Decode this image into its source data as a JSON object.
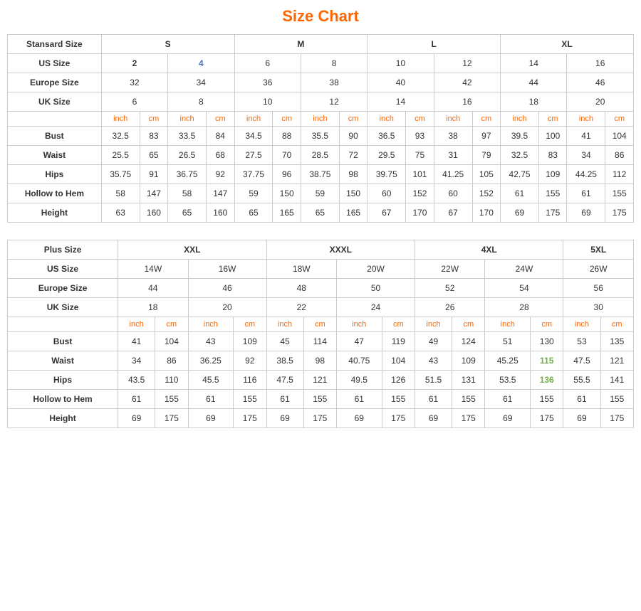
{
  "title": "Size Chart",
  "standard": {
    "table1": {
      "headers": {
        "col1": "Stansard Size",
        "s": "S",
        "m": "M",
        "l": "L",
        "xl": "XL"
      },
      "usSize": {
        "label": "US Size",
        "vals": [
          "2",
          "4",
          "6",
          "8",
          "10",
          "12",
          "14",
          "16"
        ]
      },
      "europeSize": {
        "label": "Europe Size",
        "vals": [
          "32",
          "34",
          "36",
          "38",
          "40",
          "42",
          "44",
          "46"
        ]
      },
      "ukSize": {
        "label": "UK Size",
        "vals": [
          "6",
          "8",
          "10",
          "12",
          "14",
          "16",
          "18",
          "20"
        ]
      },
      "units": [
        "inch",
        "cm",
        "inch",
        "cm",
        "inch",
        "cm",
        "inch",
        "cm",
        "inch",
        "cm",
        "inch",
        "cm",
        "inch",
        "cm",
        "inch",
        "cm"
      ],
      "bust": {
        "label": "Bust",
        "vals": [
          "32.5",
          "83",
          "33.5",
          "84",
          "34.5",
          "88",
          "35.5",
          "90",
          "36.5",
          "93",
          "38",
          "97",
          "39.5",
          "100",
          "41",
          "104"
        ]
      },
      "waist": {
        "label": "Waist",
        "vals": [
          "25.5",
          "65",
          "26.5",
          "68",
          "27.5",
          "70",
          "28.5",
          "72",
          "29.5",
          "75",
          "31",
          "79",
          "32.5",
          "83",
          "34",
          "86"
        ]
      },
      "hips": {
        "label": "Hips",
        "vals": [
          "35.75",
          "91",
          "36.75",
          "92",
          "37.75",
          "96",
          "38.75",
          "98",
          "39.75",
          "101",
          "41.25",
          "105",
          "42.75",
          "109",
          "44.25",
          "112"
        ]
      },
      "hollowToHem": {
        "label": "Hollow to Hem",
        "vals": [
          "58",
          "147",
          "58",
          "147",
          "59",
          "150",
          "59",
          "150",
          "60",
          "152",
          "60",
          "152",
          "61",
          "155",
          "61",
          "155"
        ]
      },
      "height": {
        "label": "Height",
        "vals": [
          "63",
          "160",
          "65",
          "160",
          "65",
          "165",
          "65",
          "165",
          "67",
          "170",
          "67",
          "170",
          "69",
          "175",
          "69",
          "175"
        ]
      }
    }
  },
  "plus": {
    "table2": {
      "headers": {
        "col1": "Plus Size",
        "xxl": "XXL",
        "xxxl": "XXXL",
        "fxl": "4XL",
        "fivexl": "5XL"
      },
      "usSize": {
        "label": "US Size",
        "vals": [
          "14W",
          "16W",
          "18W",
          "20W",
          "22W",
          "24W",
          "26W"
        ]
      },
      "europeSize": {
        "label": "Europe Size",
        "vals": [
          "44",
          "46",
          "48",
          "50",
          "52",
          "54",
          "56"
        ]
      },
      "ukSize": {
        "label": "UK Size",
        "vals": [
          "18",
          "20",
          "22",
          "24",
          "26",
          "28",
          "30"
        ]
      },
      "units": [
        "inch",
        "cm",
        "inch",
        "cm",
        "inch",
        "cm",
        "inch",
        "cm",
        "inch",
        "cm",
        "inch",
        "cm",
        "inch",
        "cm"
      ],
      "bust": {
        "label": "Bust",
        "vals": [
          "41",
          "104",
          "43",
          "109",
          "45",
          "114",
          "47",
          "119",
          "49",
          "124",
          "51",
          "130",
          "53",
          "135"
        ]
      },
      "waist": {
        "label": "Waist",
        "vals": [
          "34",
          "86",
          "36.25",
          "92",
          "38.5",
          "98",
          "40.75",
          "104",
          "43",
          "109",
          "45.25",
          "115",
          "47.5",
          "121"
        ]
      },
      "hips": {
        "label": "Hips",
        "vals": [
          "43.5",
          "110",
          "45.5",
          "116",
          "47.5",
          "121",
          "49.5",
          "126",
          "51.5",
          "131",
          "53.5",
          "136",
          "55.5",
          "141"
        ]
      },
      "hollowToHem": {
        "label": "Hollow to Hem",
        "vals": [
          "61",
          "155",
          "61",
          "155",
          "61",
          "155",
          "61",
          "155",
          "61",
          "155",
          "61",
          "155",
          "61",
          "155"
        ]
      },
      "height": {
        "label": "Height",
        "vals": [
          "69",
          "175",
          "69",
          "175",
          "69",
          "175",
          "69",
          "175",
          "69",
          "175",
          "69",
          "175",
          "69",
          "175"
        ]
      }
    }
  }
}
